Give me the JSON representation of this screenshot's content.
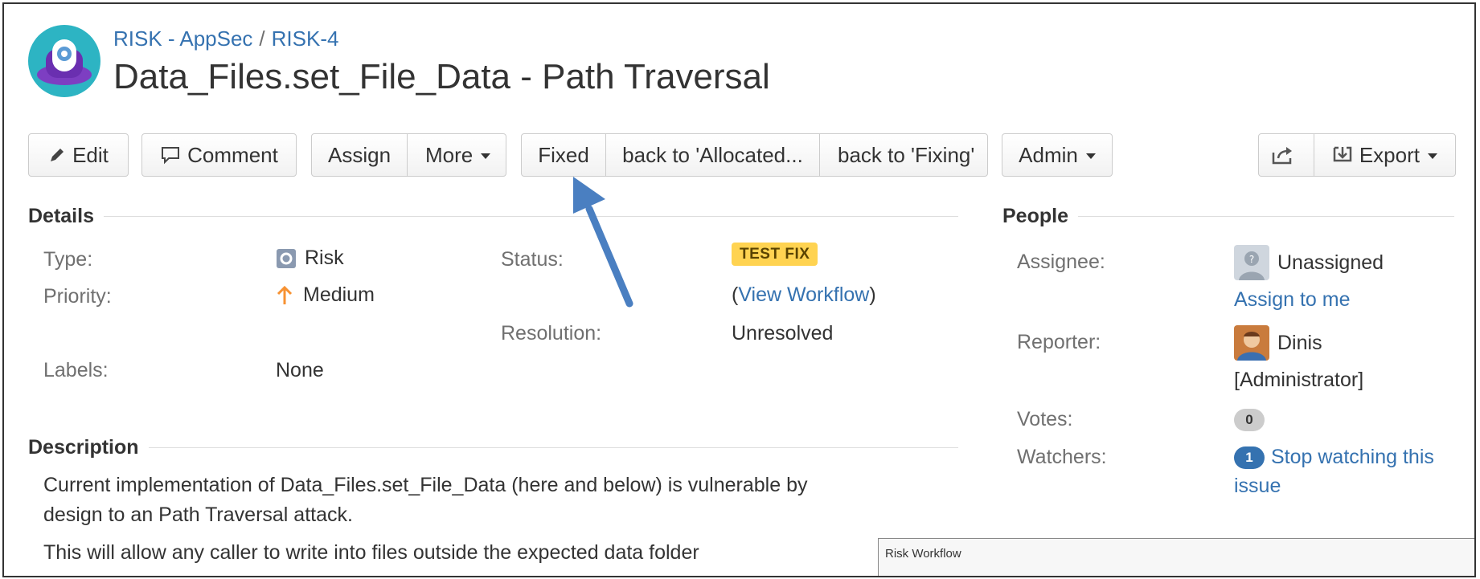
{
  "breadcrumb": {
    "project": "RISK - AppSec",
    "separator": "/",
    "issue_key": "RISK-4"
  },
  "issue": {
    "title": "Data_Files.set_File_Data - Path Traversal"
  },
  "toolbar": {
    "edit": "Edit",
    "comment": "Comment",
    "assign": "Assign",
    "more": "More",
    "fixed": "Fixed",
    "back_allocated": "back to 'Allocated...",
    "back_fixing": "back to 'Fixing'",
    "admin": "Admin",
    "export": "Export"
  },
  "details": {
    "heading": "Details",
    "type_label": "Type:",
    "type_value": "Risk",
    "priority_label": "Priority:",
    "priority_value": "Medium",
    "labels_label": "Labels:",
    "labels_value": "None",
    "status_label": "Status:",
    "status_value": "TEST FIX",
    "workflow_open": "(",
    "workflow_link": "View Workflow",
    "workflow_close": ")",
    "resolution_label": "Resolution:",
    "resolution_value": "Unresolved"
  },
  "people": {
    "heading": "People",
    "assignee_label": "Assignee:",
    "assignee_value": "Unassigned",
    "assign_to_me": "Assign to me",
    "reporter_label": "Reporter:",
    "reporter_name": "Dinis",
    "reporter_role": "[Administrator]",
    "votes_label": "Votes:",
    "votes_count": "0",
    "watchers_label": "Watchers:",
    "watchers_count": "1",
    "watch_link_line1": "Stop watching this",
    "watch_link_line2": "issue"
  },
  "description": {
    "heading": "Description",
    "line1": "Current implementation of Data_Files.set_File_Data (here and below) is vulnerable by",
    "line2": "design to an Path Traversal attack.",
    "line3": "This will allow any caller to write into files outside the expected data folder"
  },
  "workflow_panel": {
    "title": "Risk Workflow"
  },
  "colors": {
    "link": "#3572b0",
    "status": "#ffd351",
    "arrow": "#4a7fc1",
    "priority": "#f79232"
  }
}
